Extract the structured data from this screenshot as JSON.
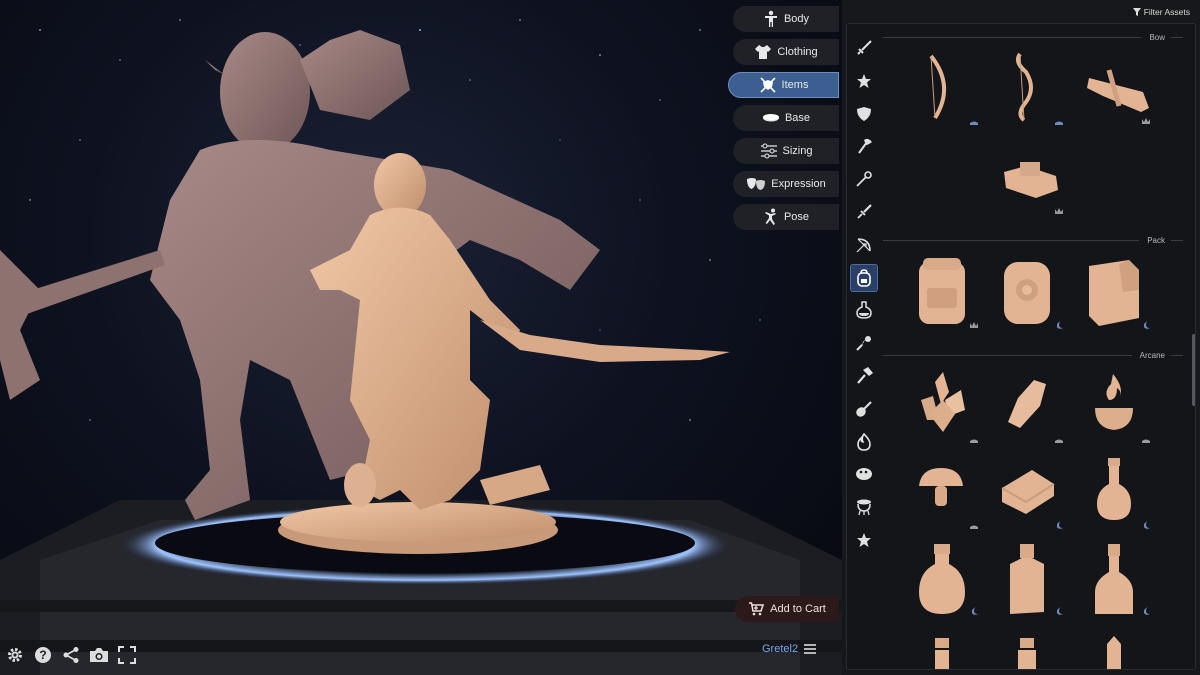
{
  "menu": {
    "categories": [
      {
        "label": "Body",
        "icon": "person-icon",
        "active": false
      },
      {
        "label": "Clothing",
        "icon": "shirt-icon",
        "active": false
      },
      {
        "label": "Items",
        "icon": "crossed-swords-shield-icon",
        "active": true
      },
      {
        "label": "Base",
        "icon": "base-disc-icon",
        "active": false
      },
      {
        "label": "Sizing",
        "icon": "sliders-icon",
        "active": false
      },
      {
        "label": "Expression",
        "icon": "theater-masks-icon",
        "active": false
      },
      {
        "label": "Pose",
        "icon": "pose-figure-icon",
        "active": false
      }
    ],
    "add_to_cart": "Add to Cart",
    "username": "Gretel2"
  },
  "toolbar": {
    "items": [
      "gear-icon",
      "help-icon",
      "share-icon",
      "camera-icon",
      "fullscreen-icon"
    ]
  },
  "panel": {
    "filter_label": "Filter Assets",
    "side_icons": [
      "sword-icon",
      "star-icon",
      "shield-icon",
      "axe-icon",
      "staff-icon",
      "dagger-icon",
      "bow-icon",
      "backpack-icon",
      "potion-icon",
      "flail-icon",
      "hammer-icon",
      "lute-icon",
      "flame-icon",
      "creature-icon",
      "cauldron-icon",
      "star-outline-icon"
    ],
    "active_side_icon": "backpack-icon",
    "sections": [
      {
        "title": "Bow",
        "items": [
          {
            "name": "longbow",
            "badge": "hand-icon"
          },
          {
            "name": "recurve-bow",
            "badge": "hand-icon"
          },
          {
            "name": "crossbow",
            "badge": "crown-icon"
          },
          {
            "name": "repeating-crossbow",
            "badge": "crown-icon"
          }
        ]
      },
      {
        "title": "Pack",
        "items": [
          {
            "name": "large-backpack",
            "badge": "crown-icon"
          },
          {
            "name": "round-satchel",
            "badge": "moon-icon"
          },
          {
            "name": "box-pack",
            "badge": "moon-icon"
          }
        ]
      },
      {
        "title": "Arcane",
        "items": [
          {
            "name": "crystal-cluster",
            "badge": "hand-icon"
          },
          {
            "name": "single-crystal",
            "badge": "hand-icon"
          },
          {
            "name": "fire-bowl",
            "badge": "hand-icon"
          },
          {
            "name": "mushroom",
            "badge": "hand-icon"
          },
          {
            "name": "spell-book",
            "badge": "moon-icon"
          },
          {
            "name": "round-potion",
            "badge": "moon-icon"
          },
          {
            "name": "gourd-bottle",
            "badge": "moon-icon"
          },
          {
            "name": "square-bottle",
            "badge": "moon-icon"
          },
          {
            "name": "tall-bottle",
            "badge": "moon-icon"
          }
        ]
      }
    ]
  },
  "colors": {
    "accent": "#3c5e90",
    "miniature": "#e2b494",
    "troll": "#a0807d",
    "ring_glow": "#bcd6ff",
    "badge_blue": "#6f8cc2",
    "badge_grey": "#9a9a9a"
  }
}
